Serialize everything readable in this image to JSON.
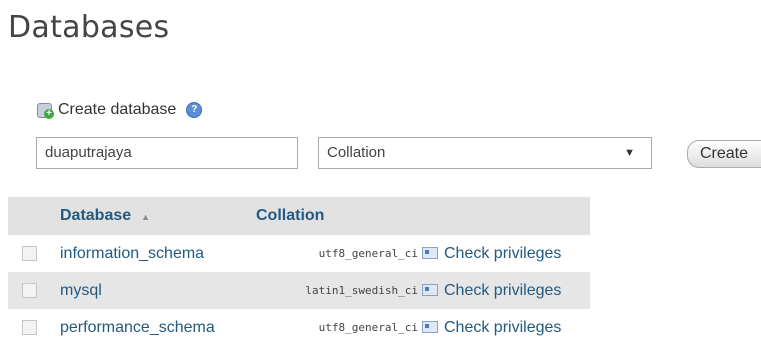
{
  "page": {
    "title": "Databases"
  },
  "create_form": {
    "heading": "Create database",
    "name_value": "duaputrajaya",
    "collation_value": "Collation",
    "collation_arrow": "▼",
    "create_button": "Create"
  },
  "table": {
    "headers": {
      "database": "Database",
      "sort_indicator": "▲",
      "collation": "Collation"
    },
    "rows": [
      {
        "name": "information_schema",
        "collation": "utf8_general_ci",
        "action": "Check privileges"
      },
      {
        "name": "mysql",
        "collation": "latin1_swedish_ci",
        "action": "Check privileges"
      },
      {
        "name": "performance_schema",
        "collation": "utf8_general_ci",
        "action": "Check privileges"
      }
    ]
  },
  "icons": {
    "create_db_icon": "database-add-icon",
    "help_icon": "help-icon",
    "privileges_icon": "privileges-icon"
  },
  "colors": {
    "link": "#235a81",
    "header_bg": "#e2e2e2",
    "stripe_bg": "#e6e6e6"
  }
}
